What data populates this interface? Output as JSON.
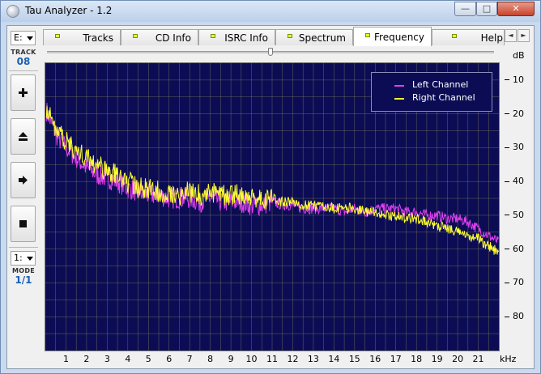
{
  "window": {
    "title": "Tau Analyzer - 1.2",
    "minimize_glyph": "—",
    "maximize_glyph": "□",
    "close_glyph": "✕"
  },
  "left_panel": {
    "drive": "E:",
    "track_label": "TRACK",
    "track_number": "08",
    "buttons": [
      "plus-icon",
      "eject-icon",
      "play-icon",
      "stop-icon"
    ],
    "mode_select": "1:",
    "mode_label": "MODE",
    "mode_value": "1/1"
  },
  "tabs": [
    {
      "label": "Tracks",
      "active": false
    },
    {
      "label": "CD Info",
      "active": false
    },
    {
      "label": "ISRC Info",
      "active": false
    },
    {
      "label": "Spectrum",
      "active": false
    },
    {
      "label": "Frequency",
      "active": true
    },
    {
      "label": "Help",
      "active": false
    }
  ],
  "tab_scroll": {
    "left": "◄",
    "right": "►"
  },
  "colors": {
    "plot_background": "#0c0c55",
    "grid": "#8a8a5a",
    "left_channel": "#e040f0",
    "right_channel": "#ffff30",
    "tab_indicator": "#e8ff2f"
  },
  "chart_data": {
    "type": "line",
    "xlabel": "kHz",
    "ylabel": "dB",
    "x_ticks": [
      "1",
      "2",
      "3",
      "4",
      "5",
      "6",
      "7",
      "8",
      "9",
      "10",
      "11",
      "12",
      "13",
      "14",
      "15",
      "16",
      "17",
      "18",
      "19",
      "20",
      "21"
    ],
    "y_ticks": [
      "10",
      "20",
      "30",
      "40",
      "50",
      "60",
      "70",
      "80"
    ],
    "xlim": [
      0,
      22
    ],
    "ylim": [
      -90,
      -5
    ],
    "grid": true,
    "legend_position": "top-right",
    "series": [
      {
        "name": "Left Channel",
        "color": "#e040f0",
        "x": [
          0.05,
          0.3,
          0.6,
          1,
          1.5,
          2,
          2.5,
          3,
          3.5,
          4,
          4.5,
          5,
          5.5,
          6,
          6.5,
          7,
          7.5,
          8,
          8.5,
          9,
          9.5,
          10,
          10.5,
          11,
          11.5,
          12,
          12.5,
          13,
          13.5,
          14,
          14.5,
          15,
          15.5,
          16,
          16.5,
          17,
          17.5,
          18,
          18.5,
          19,
          19.5,
          20,
          20.5,
          21,
          21.5,
          22
        ],
        "y": [
          -19,
          -23,
          -27,
          -30,
          -33,
          -36,
          -38,
          -39,
          -40,
          -42,
          -43,
          -44,
          -44,
          -45,
          -45,
          -45,
          -46,
          -45,
          -46,
          -46,
          -46,
          -47,
          -47,
          -46,
          -47,
          -47,
          -48,
          -48,
          -48,
          -48,
          -49,
          -48,
          -49,
          -48,
          -48,
          -48,
          -49,
          -49,
          -50,
          -50,
          -51,
          -51,
          -52,
          -54,
          -56,
          -58
        ]
      },
      {
        "name": "Right Channel",
        "color": "#ffff30",
        "x": [
          0.05,
          0.3,
          0.6,
          1,
          1.5,
          2,
          2.5,
          3,
          3.5,
          4,
          4.5,
          5,
          5.5,
          6,
          6.5,
          7,
          7.5,
          8,
          8.5,
          9,
          9.5,
          10,
          10.5,
          11,
          11.5,
          12,
          12.5,
          13,
          13.5,
          14,
          14.5,
          15,
          15.5,
          16,
          16.5,
          17,
          17.5,
          18,
          18.5,
          19,
          19.5,
          20,
          20.5,
          21,
          21.5,
          22
        ],
        "y": [
          -18,
          -22,
          -25,
          -28,
          -31,
          -33,
          -35,
          -37,
          -38,
          -40,
          -42,
          -42,
          -43,
          -43,
          -44,
          -43,
          -44,
          -43,
          -44,
          -44,
          -44,
          -45,
          -45,
          -45,
          -46,
          -46,
          -47,
          -47,
          -47,
          -48,
          -48,
          -48,
          -49,
          -49,
          -50,
          -50,
          -51,
          -51,
          -52,
          -53,
          -54,
          -55,
          -56,
          -57,
          -59,
          -61
        ]
      }
    ]
  }
}
